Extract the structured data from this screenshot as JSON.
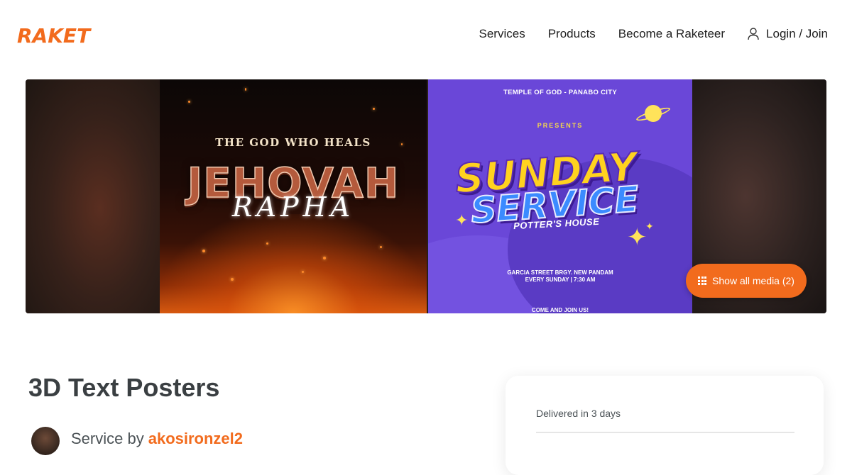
{
  "header": {
    "logo": "RAKET",
    "nav": {
      "services": "Services",
      "products": "Products",
      "become": "Become a Raketeer",
      "login": "Login / Join"
    }
  },
  "gallery": {
    "poster1": {
      "tagline": "THE GOD WHO HEALS",
      "title": "JEHOVAH",
      "script": "RAPHA"
    },
    "poster2": {
      "top": "TEMPLE OF GOD - PANABO CITY",
      "presents": "PRESENTS",
      "line1": "SUNDAY",
      "line2": "SERVICE",
      "subtitle": "POTTER'S HOUSE",
      "address_line1": "GARCIA STREET BRGY. NEW PANDAM",
      "address_line2": "EVERY SUNDAY | 7:30 AM",
      "join": "COME AND JOIN US!"
    },
    "show_all_label": "Show all media (2)",
    "accent_color": "#f26b1d"
  },
  "service": {
    "title": "3D Text Posters",
    "by_prefix": "Service by",
    "seller": "akosironzel2"
  },
  "side_card": {
    "delivered": "Delivered in 3 days"
  }
}
